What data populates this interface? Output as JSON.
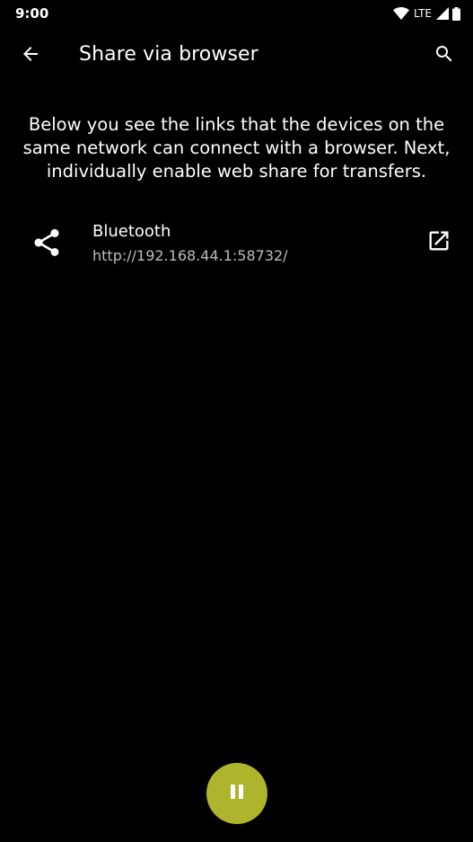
{
  "status_bar": {
    "time": "9:00",
    "network": "LTE",
    "icons": [
      "wifi-icon",
      "signal-icon",
      "battery-icon"
    ]
  },
  "app_bar": {
    "title": "Share via browser",
    "back_icon": "arrow-back-icon",
    "search_icon": "search-icon"
  },
  "description": "Below you see the links that the devices on the same network can connect with a browser. Next, individually enable web share for transfers.",
  "connections": [
    {
      "icon": "share-icon",
      "title": "Bluetooth",
      "url": "http://192.168.44.1:58732/",
      "action_icon": "open-in-new-icon"
    }
  ],
  "fab": {
    "icon": "pause-icon"
  },
  "colors": {
    "background": "#000000",
    "text": "#ffffff",
    "secondary_text": "#bdbdbd",
    "fab": "#aeb42b"
  }
}
